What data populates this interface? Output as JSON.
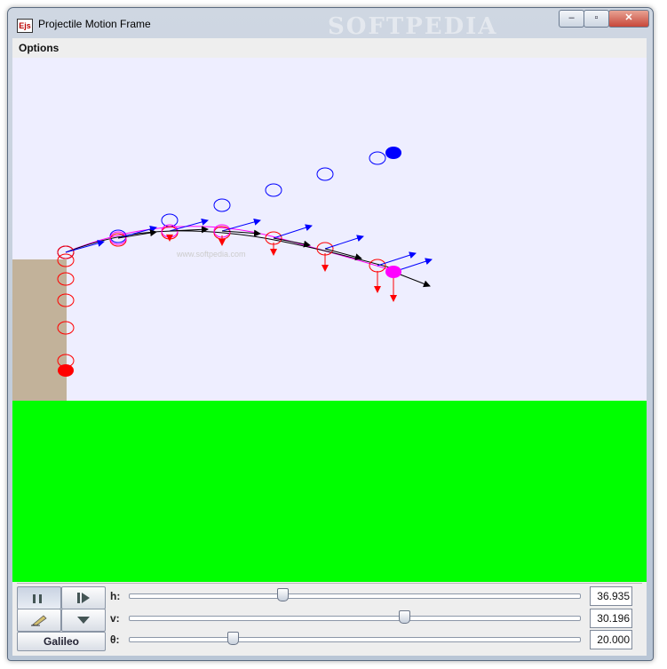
{
  "window": {
    "title": "Projectile Motion Frame",
    "icon_text": "Ejs",
    "watermark": "SOFTPEDIA"
  },
  "menu": {
    "options_label": "Options"
  },
  "scene": {
    "sky_color": "#eeeeff",
    "ground_color": "#00ff00",
    "cliff_color": "#c2b29a",
    "velocity_color": "#0000ff",
    "gravity_color": "#ff0000",
    "force_color": "#000000",
    "trail_color": "#ff00ff",
    "center_watermark": "www.softpedia.com"
  },
  "controls": {
    "galileo_label": "Galileo",
    "sliders": [
      {
        "label": "h:",
        "value": "36.935",
        "fraction": 0.34
      },
      {
        "label": "v:",
        "value": "30.196",
        "fraction": 0.61
      },
      {
        "label": "θ:",
        "value": "20.000",
        "fraction": 0.23
      }
    ]
  }
}
